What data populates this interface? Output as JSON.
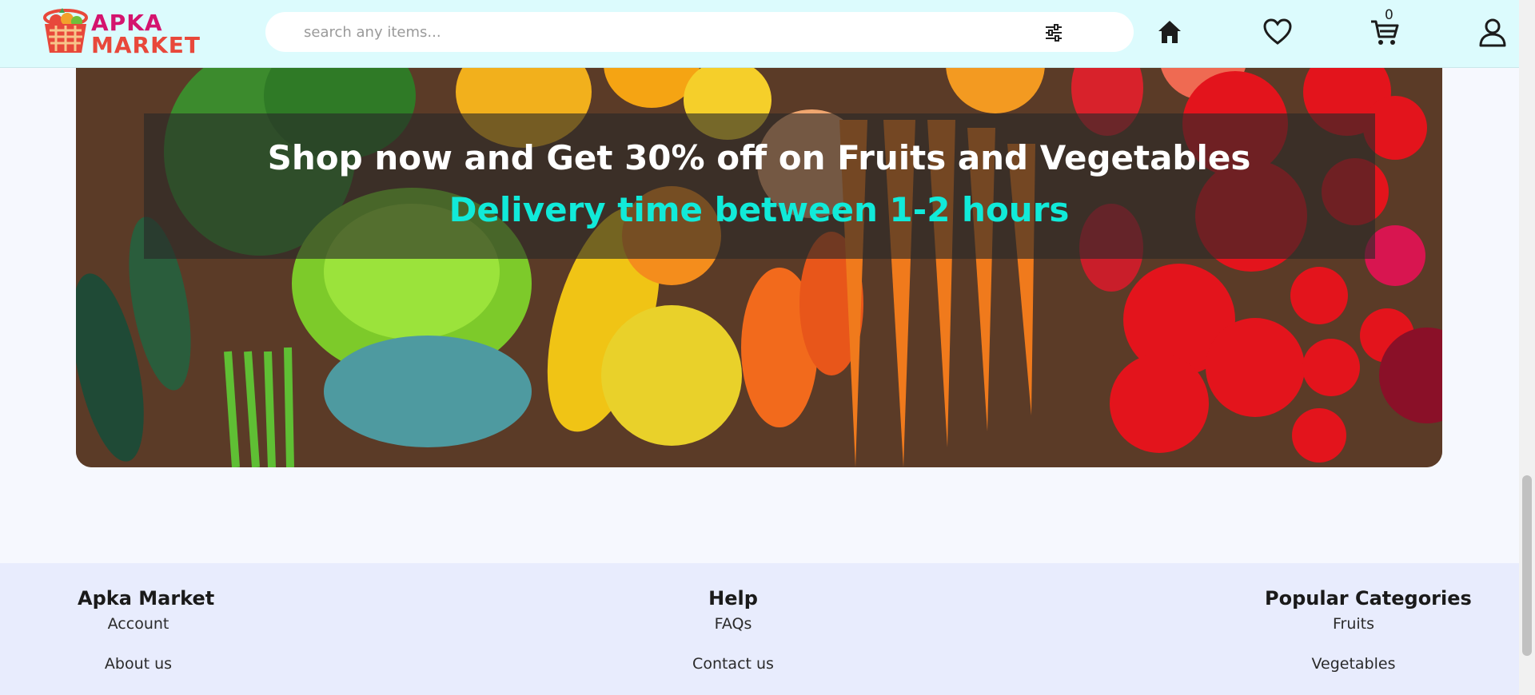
{
  "header": {
    "logo_line1": "APKA",
    "logo_line2": "MARKET",
    "search_placeholder": "search any items...",
    "cart_count": "0",
    "icons": [
      "filter-icon",
      "home-icon",
      "heart-icon",
      "cart-icon",
      "user-icon"
    ]
  },
  "banner": {
    "title": "Shop now and Get 30% off on Fruits and Vegetables",
    "subtitle": "Delivery time between 1-2 hours"
  },
  "footer": {
    "columns": [
      {
        "heading": "Apka Market",
        "links": [
          "Account",
          "About us"
        ]
      },
      {
        "heading": "Help",
        "links": [
          "FAQs",
          "Contact us"
        ]
      },
      {
        "heading": "Popular Categories",
        "links": [
          "Fruits",
          "Vegetables"
        ]
      }
    ]
  },
  "colors": {
    "header_bg": "#dcfbfd",
    "page_bg": "#f6f8fe",
    "footer_bg": "#e8ecfd",
    "banner_subtitle": "#11ead9",
    "logo_pink": "#d4146e",
    "logo_red": "#e8483b"
  }
}
